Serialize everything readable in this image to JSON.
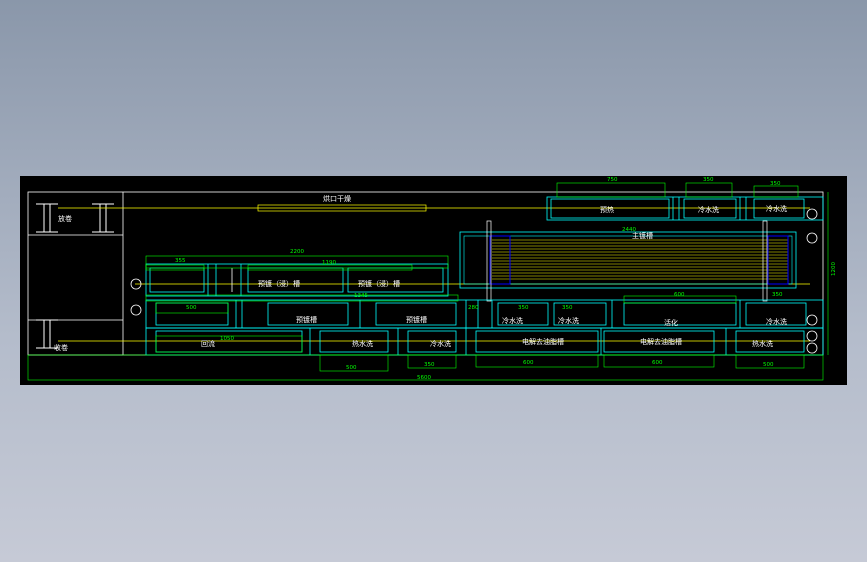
{
  "drawing": {
    "labels": {
      "fangjuan": "放卷",
      "shoujuan": "收卷",
      "hongkou": "烘口干燥",
      "yure": "预热",
      "lengshui_top1": "冷水洗",
      "lengshui_top2": "冷水洗",
      "zhudu": "主镀槽",
      "yudu1": "预镀（浸）槽",
      "yudu2": "预镀（浸）槽",
      "yudu_a": "预镀槽",
      "yudu_b": "预镀槽",
      "lengshui_m1": "冷水洗",
      "lengshui_m2": "冷水洗",
      "huoxing": "活化",
      "lengshui_m3": "冷水洗",
      "huiliu": "回流",
      "reshui_b1": "热水洗",
      "lengshui_b1": "冷水洗",
      "dianjie1": "电解去油脂槽",
      "dianjie2": "电解去油脂槽",
      "reshui_b2": "热水洗"
    },
    "dims": {
      "d_750": "750",
      "d_350a": "350",
      "d_350b": "350",
      "d_2440": "2440",
      "d_2200": "2200",
      "d_355": "355",
      "d_1190": "1190",
      "d_1345": "1345",
      "d_500a": "500",
      "d_280": "280",
      "d_350c": "350",
      "d_350d": "350",
      "d_600a": "600",
      "d_350e": "350",
      "d_1050": "1050",
      "d_500b": "500",
      "d_350f": "350",
      "d_600b": "600",
      "d_600c": "600",
      "d_500c": "500",
      "d_5600": "5600",
      "d_1200": "1200"
    }
  }
}
